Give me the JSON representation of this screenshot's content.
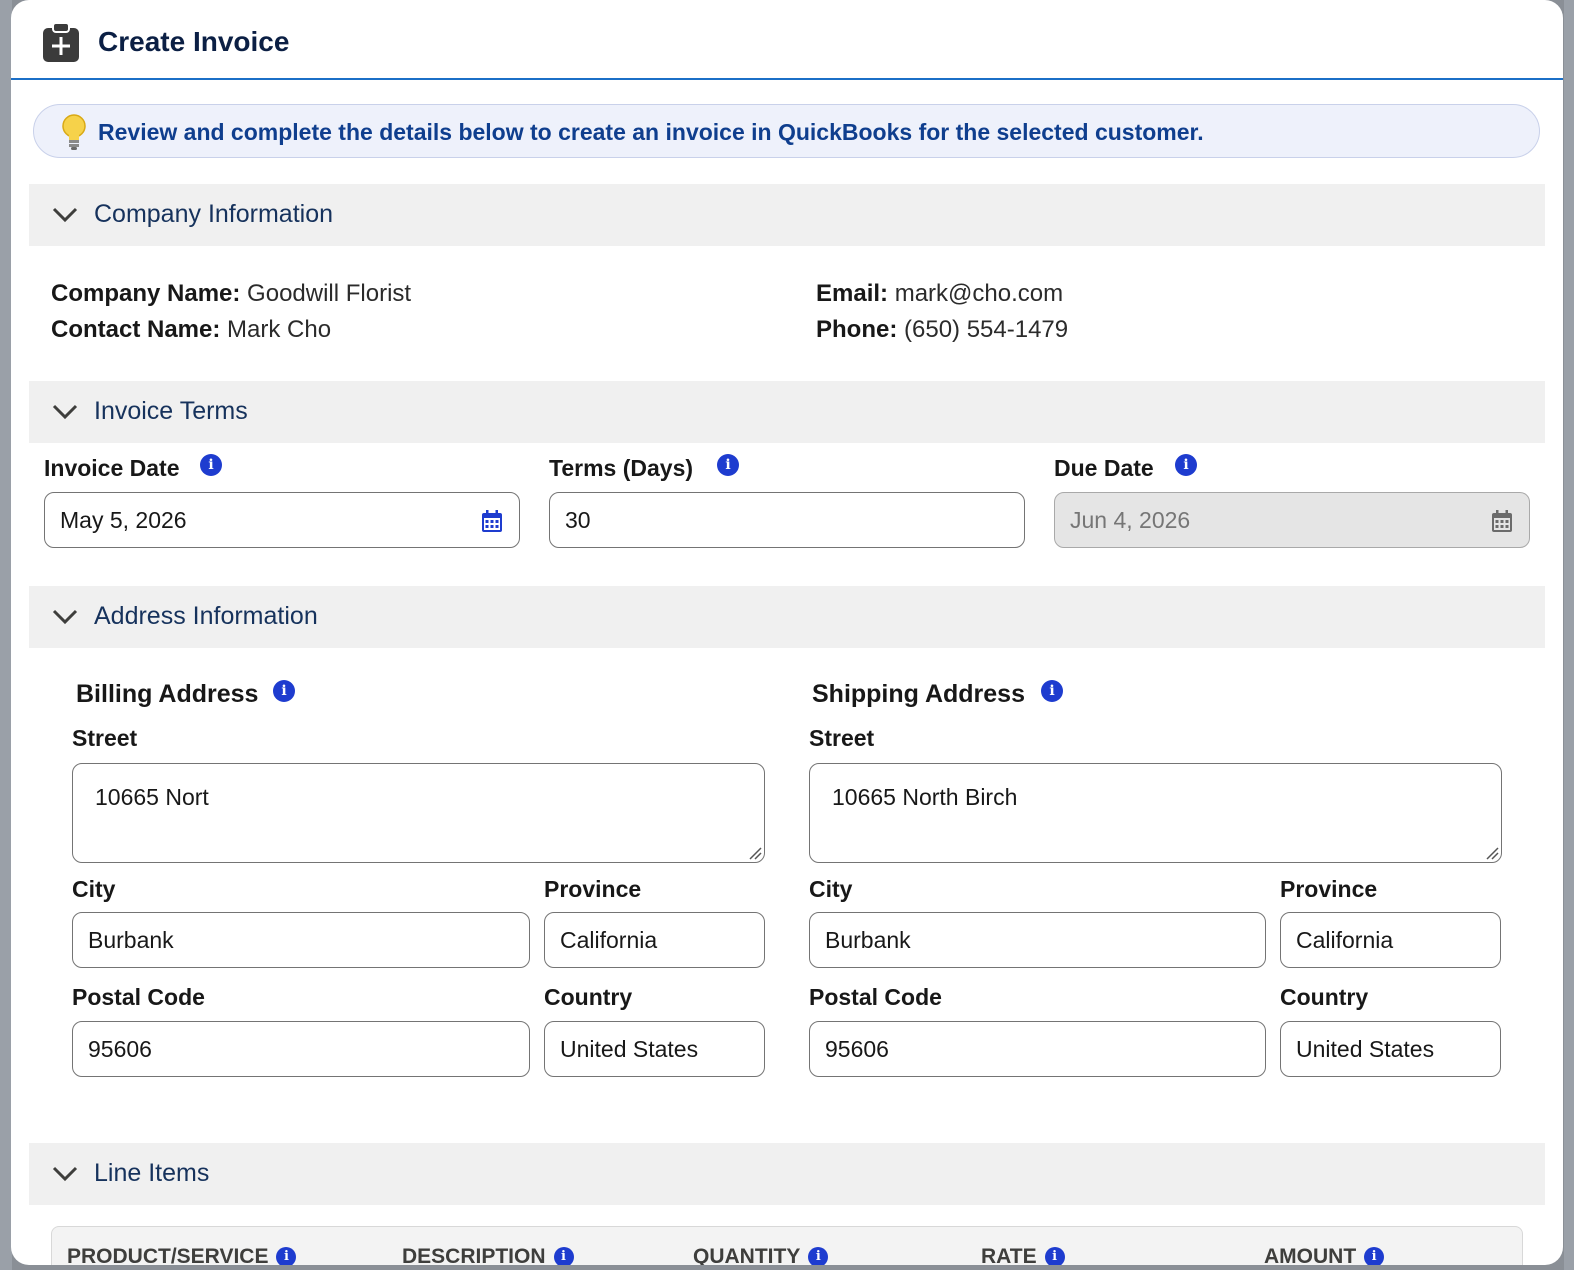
{
  "modal": {
    "title": "Create Invoice",
    "notice": "Review and complete the details below to create an invoice in QuickBooks for the selected customer."
  },
  "company_section": {
    "title": "Company Information",
    "company_name_label": "Company Name:",
    "company_name": "Goodwill Florist",
    "contact_name_label": "Contact Name:",
    "contact_name": "Mark Cho",
    "email_label": "Email:",
    "email": "mark@cho.com",
    "phone_label": "Phone:",
    "phone": "(650) 554-1479"
  },
  "terms_section": {
    "title": "Invoice Terms",
    "invoice_date_label": "Invoice Date",
    "invoice_date": "May 5, 2026",
    "terms_label": "Terms (Days)",
    "terms": "30",
    "due_date_label": "Due Date",
    "due_date": "Jun 4, 2026"
  },
  "address_section": {
    "title": "Address Information",
    "billing": {
      "heading": "Billing Address",
      "street_label": "Street",
      "street": "10665 Nort",
      "city_label": "City",
      "city": "Burbank",
      "province_label": "Province",
      "province": "California",
      "postal_label": "Postal Code",
      "postal": "95606",
      "country_label": "Country",
      "country": "United States"
    },
    "shipping": {
      "heading": "Shipping Address",
      "street_label": "Street",
      "street": "10665 North Birch",
      "city_label": "City",
      "city": "Burbank",
      "province_label": "Province",
      "province": "California",
      "postal_label": "Postal Code",
      "postal": "95606",
      "country_label": "Country",
      "country": "United States"
    }
  },
  "line_items_section": {
    "title": "Line Items",
    "columns": [
      "PRODUCT/SERVICE",
      "DESCRIPTION",
      "QUANTITY",
      "RATE",
      "AMOUNT"
    ]
  },
  "colors": {
    "accent": "#1b6fc7",
    "info_icon": "#1e3ccf",
    "notice_text": "#0f3e8e",
    "section_bg": "#f0f0f0"
  },
  "icons": {
    "header": "clipboard-plus-icon",
    "notice": "lightbulb-icon",
    "section_toggle": "chevron-down-icon",
    "info": "info-icon",
    "date": "calendar-icon"
  }
}
